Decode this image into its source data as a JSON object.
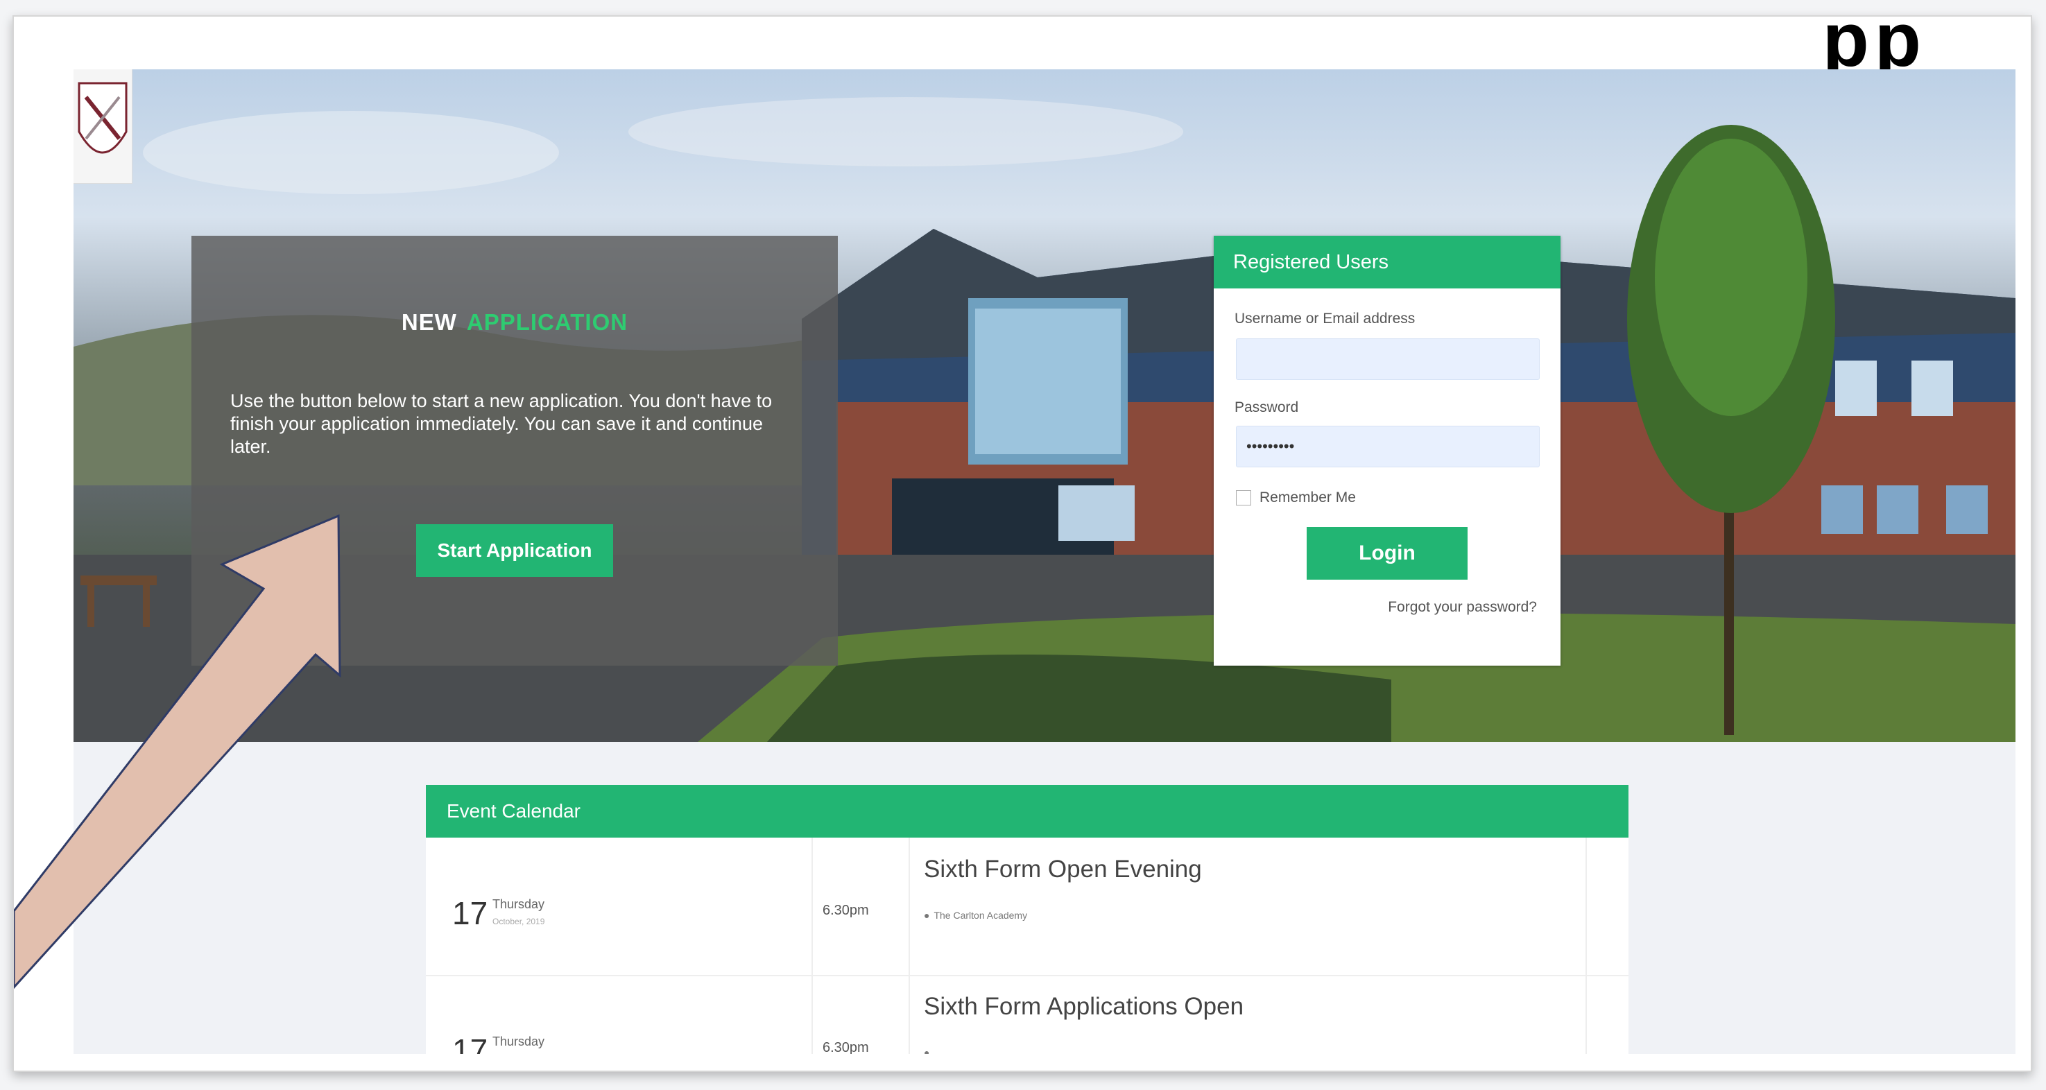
{
  "page": {
    "title_fragment": "pp"
  },
  "new_application": {
    "title_white": "NEW",
    "title_green": "APPLICATION",
    "description": "Use the button below to start a new application. You don't have to finish your application immediately. You can save it and continue later.",
    "button_label": "Start Application"
  },
  "login": {
    "heading": "Registered Users",
    "username_label": "Username or Email address",
    "username_value": "",
    "password_label": "Password",
    "password_value": "•••••••••",
    "remember_label": "Remember Me",
    "login_label": "Login",
    "forgot_label": "Forgot your password?"
  },
  "events": {
    "heading": "Event Calendar",
    "items": [
      {
        "day": "17",
        "weekday": "Thursday",
        "month_year": "October, 2019",
        "time": "6.30pm",
        "title": "Sixth Form Open Evening",
        "location": "The Carlton Academy"
      },
      {
        "day": "17",
        "weekday": "Thursday",
        "month_year": "",
        "time": "6.30pm",
        "title": "Sixth Form Applications Open",
        "location": ""
      }
    ]
  },
  "colors": {
    "accent": "#22b573",
    "arrow": "#e2bfae"
  }
}
